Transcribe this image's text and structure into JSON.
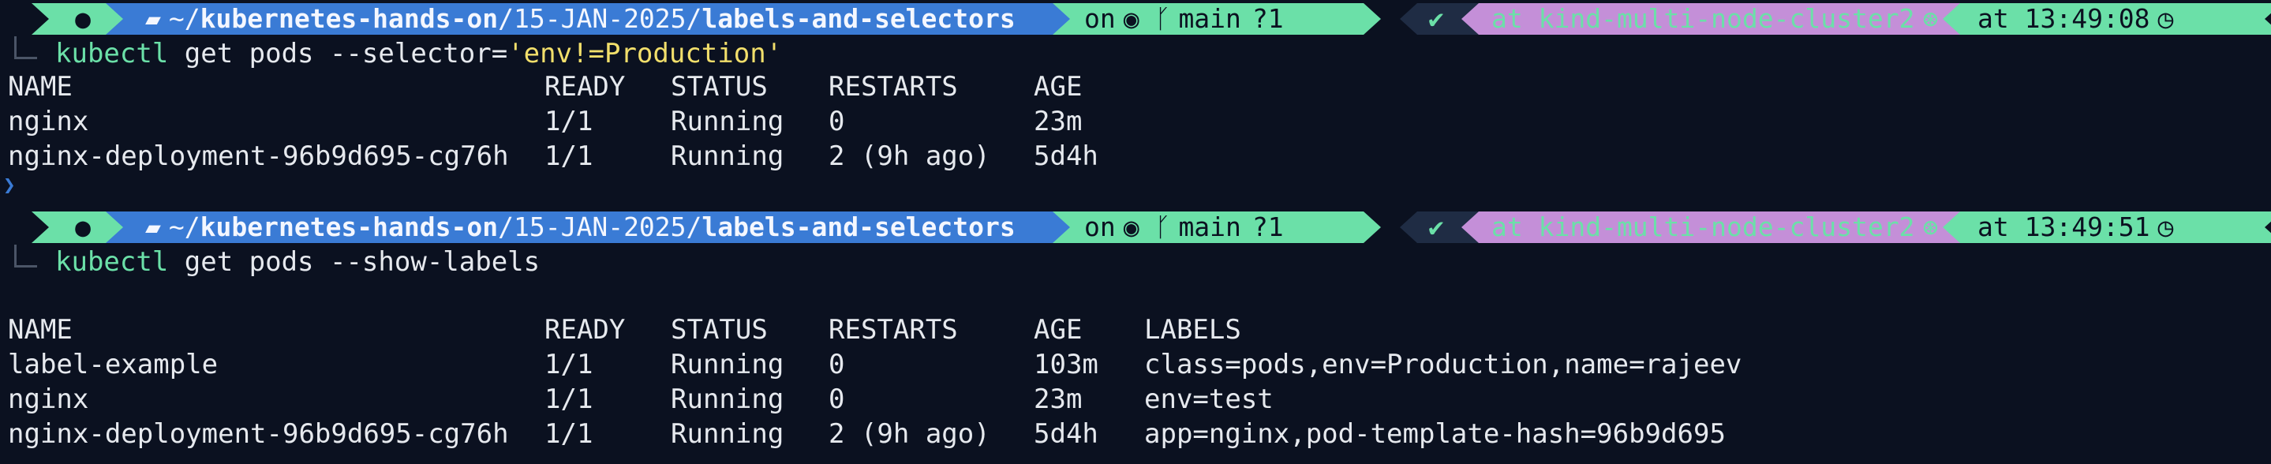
{
  "prompts": [
    {
      "path_prefix": "~/",
      "path_bold1": "kubernetes-hands-on",
      "path_mid": "/15-JAN-2025/",
      "path_bold2": "labels-and-selectors",
      "git_on": "on",
      "git_branch": "main",
      "git_status": "?1",
      "status_check": "✔",
      "context": "at kind-multi-node-cluster2",
      "time": "at 13:49:08"
    },
    {
      "path_prefix": "~/",
      "path_bold1": "kubernetes-hands-on",
      "path_mid": "/15-JAN-2025/",
      "path_bold2": "labels-and-selectors",
      "git_on": "on",
      "git_branch": "main",
      "git_status": "?1",
      "status_check": "✔",
      "context": "at kind-multi-node-cluster2",
      "time": "at 13:49:51"
    }
  ],
  "commands": [
    {
      "cmd": "kubectl",
      "args": " get pods --selector=",
      "str": "'env!=Production'"
    },
    {
      "cmd": "kubectl",
      "args": " get pods --show-labels",
      "str": ""
    }
  ],
  "table1": {
    "headers": [
      "NAME",
      "READY",
      "STATUS",
      "RESTARTS",
      "AGE"
    ],
    "rows": [
      [
        "nginx",
        "1/1",
        "Running",
        "0",
        "23m"
      ],
      [
        "nginx-deployment-96b9d695-cg76h",
        "1/1",
        "Running",
        "2 (9h ago)",
        "5d4h"
      ]
    ]
  },
  "table2": {
    "headers": [
      "NAME",
      "READY",
      "STATUS",
      "RESTARTS",
      "AGE",
      "LABELS"
    ],
    "rows": [
      [
        "label-example",
        "1/1",
        "Running",
        "0",
        "103m",
        "class=pods,env=Production,name=rajeev"
      ],
      [
        "nginx",
        "1/1",
        "Running",
        "0",
        "23m",
        "env=test"
      ],
      [
        "nginx-deployment-96b9d695-cg76h",
        "1/1",
        "Running",
        "2 (9h ago)",
        "5d4h",
        "app=nginx,pod-template-hash=96b9d695"
      ]
    ]
  },
  "glyphs": {
    "apple_icon": "",
    "folder_icon": "▰",
    "github_icon": "◉",
    "branch_icon": "ᚴ",
    "ctx_icon": "⊛",
    "clock_icon": "◷",
    "caret": "❯"
  },
  "colors": {
    "background": "#0b1120",
    "mint": "#6be0a8",
    "blue": "#3a7bd5",
    "violet": "#c48fd8",
    "yellow": "#f2df6b"
  }
}
